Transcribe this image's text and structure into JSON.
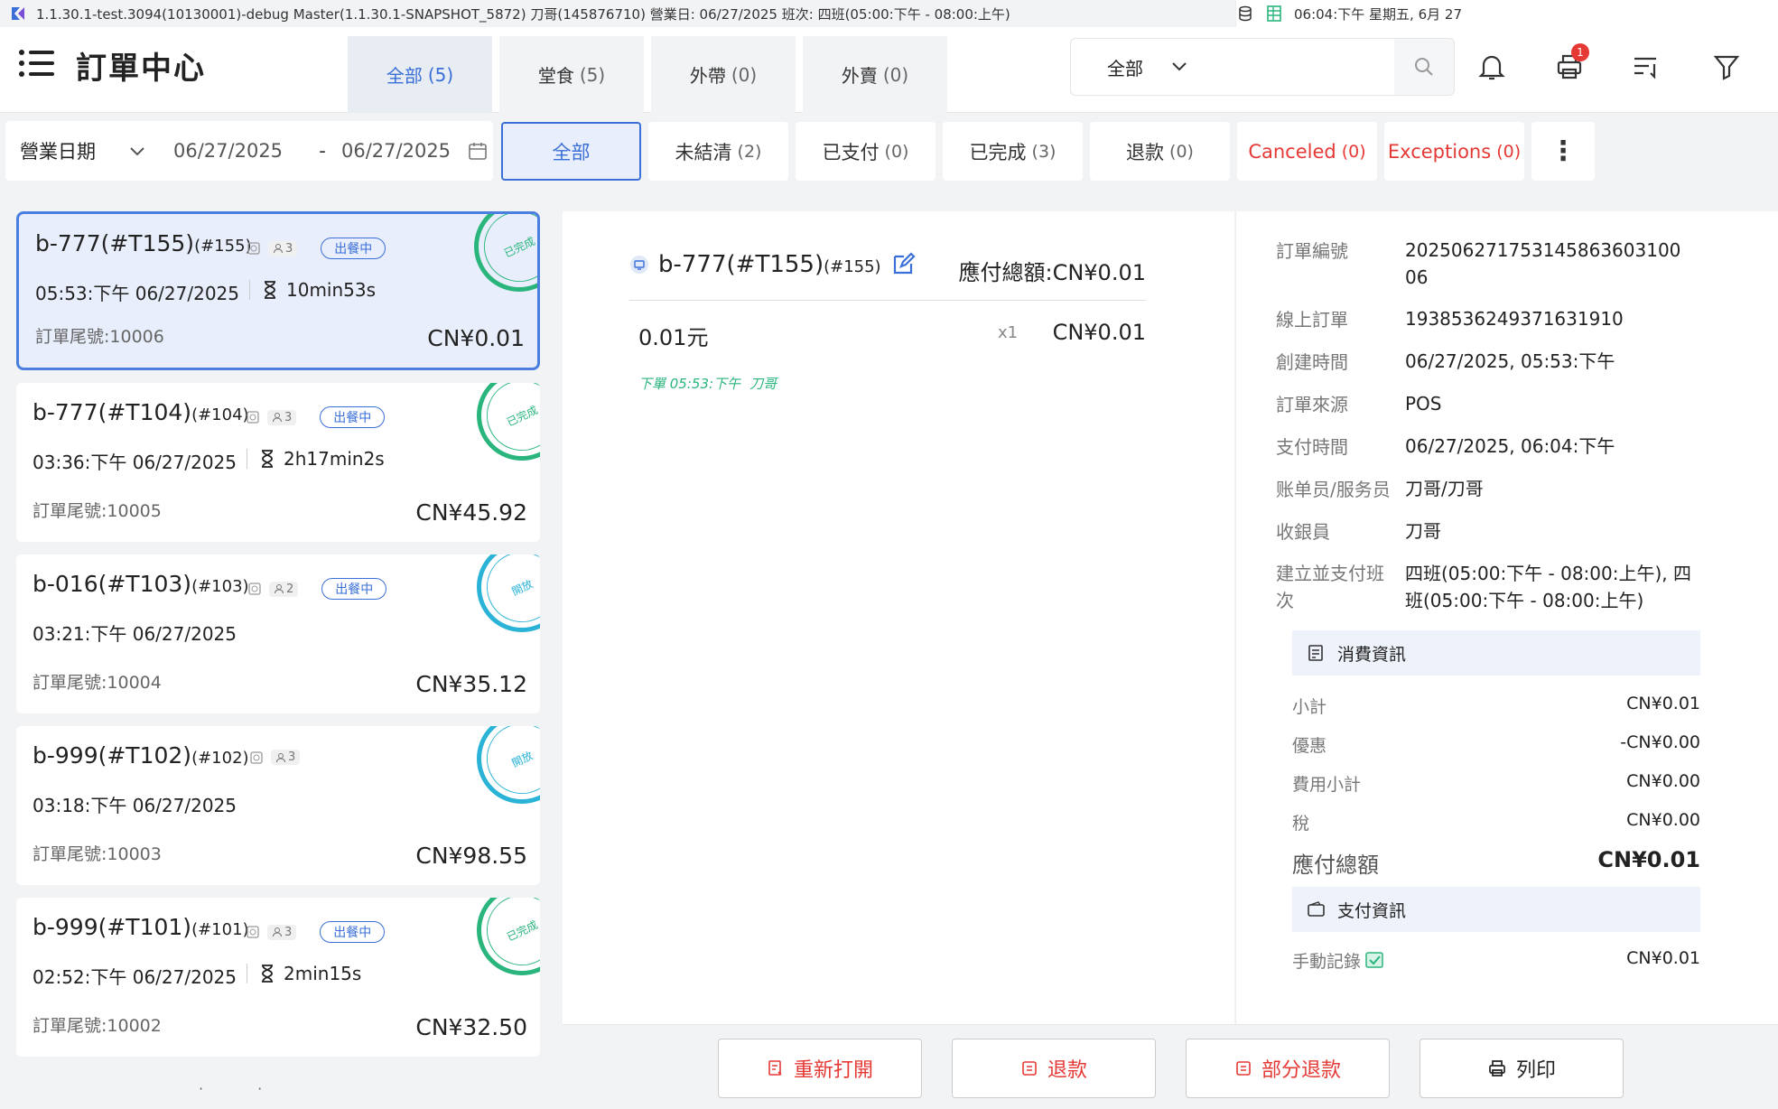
{
  "status_bar": {
    "info": "1.1.30.1-test.3094(10130001)-debug   Master(1.1.30.1-SNAPSHOT_5872)   刀哥(145876710)   營業日: 06/27/2025   班次:   四班(05:00:下午 - 08:00:上午)",
    "clock": "06:04:下午 星期五, 6月 27"
  },
  "header": {
    "title": "訂單中心",
    "tabs": [
      {
        "label": "全部",
        "count": "(5)"
      },
      {
        "label": "堂食",
        "count": "(5)"
      },
      {
        "label": "外帶",
        "count": "(0)"
      },
      {
        "label": "外賣",
        "count": "(0)"
      }
    ],
    "search_select": "全部",
    "notification_badge": "1"
  },
  "filter": {
    "date_label": "營業日期",
    "date_from": "06/27/2025",
    "date_sep": "-",
    "date_to": "06/27/2025",
    "tabs": [
      {
        "label": "全部",
        "count": ""
      },
      {
        "label": "未結清",
        "count": "(2)"
      },
      {
        "label": "已支付",
        "count": "(0)"
      },
      {
        "label": "已完成",
        "count": "(3)"
      },
      {
        "label": "退款",
        "count": "(0)"
      },
      {
        "label": "Canceled",
        "count": "(0)"
      },
      {
        "label": "Exceptions",
        "count": "(0)"
      }
    ],
    "more": "⋮"
  },
  "orders": [
    {
      "name": "b-777(#T155)",
      "num": "(#155)",
      "persons": "3",
      "pill": "出餐中",
      "time": "05:53:下午 06/27/2025",
      "duration": "10min53s",
      "tail": "訂單尾號:10006",
      "amount": "CN¥0.01",
      "stamp": "已完成"
    },
    {
      "name": "b-777(#T104)",
      "num": "(#104)",
      "persons": "3",
      "pill": "出餐中",
      "time": "03:36:下午 06/27/2025",
      "duration": "2h17min2s",
      "tail": "訂單尾號:10005",
      "amount": "CN¥45.92",
      "stamp": "已完成"
    },
    {
      "name": "b-016(#T103)",
      "num": "(#103)",
      "persons": "2",
      "pill": "出餐中",
      "time": "03:21:下午 06/27/2025",
      "duration": "",
      "tail": "訂單尾號:10004",
      "amount": "CN¥35.12",
      "stamp": "開放"
    },
    {
      "name": "b-999(#T102)",
      "num": "(#102)",
      "persons": "3",
      "pill": "",
      "time": "03:18:下午 06/27/2025",
      "duration": "",
      "tail": "訂單尾號:10003",
      "amount": "CN¥98.55",
      "stamp": "開放"
    },
    {
      "name": "b-999(#T101)",
      "num": "(#101)",
      "persons": "3",
      "pill": "出餐中",
      "time": "02:52:下午 06/27/2025",
      "duration": "2min15s",
      "tail": "訂單尾號:10002",
      "amount": "CN¥32.50",
      "stamp": "已完成"
    }
  ],
  "detail": {
    "title": "b-777(#T155)",
    "num": "(#155)",
    "total": "應付總額:CN¥0.01",
    "item_name": "0.01元",
    "item_qty": "x1",
    "item_price": "CN¥0.01",
    "note_time": "下單 05:53:下午",
    "note_user": "刀哥"
  },
  "info": {
    "rows": [
      {
        "k": "訂單編號",
        "v": "20250627175314586360310006"
      },
      {
        "k": "線上訂單",
        "v": "1938536249371631910"
      },
      {
        "k": "創建時間",
        "v": "06/27/2025, 05:53:下午"
      },
      {
        "k": "訂單來源",
        "v": "POS"
      },
      {
        "k": "支付時間",
        "v": "06/27/2025, 06:04:下午"
      },
      {
        "k": "账单员/服务员",
        "v": "刀哥/刀哥"
      },
      {
        "k": "收銀員",
        "v": "刀哥"
      },
      {
        "k": "建立並支付班次",
        "v": "四班(05:00:下午 - 08:00:上午), 四班(05:00:下午 - 08:00:上午)"
      }
    ],
    "consume_title": "消費資訊",
    "subtotal_k": "小計",
    "subtotal_v": "CN¥0.01",
    "discount_k": "優惠",
    "discount_v": "-CN¥0.00",
    "fee_k": "費用小計",
    "fee_v": "CN¥0.00",
    "tax_k": "稅",
    "tax_v": "CN¥0.00",
    "due_k": "應付總額",
    "due_v": "CN¥0.01",
    "payment_title": "支付資訊",
    "manual_k": "手動記錄",
    "manual_v": "CN¥0.01"
  },
  "actions": {
    "reopen": "重新打開",
    "refund": "退款",
    "partial_refund": "部分退款",
    "print": "列印"
  },
  "colors": {
    "accent": "#3a6fd8",
    "danger": "#e53935",
    "done": "#2ab57d",
    "open": "#2ab3d6"
  }
}
